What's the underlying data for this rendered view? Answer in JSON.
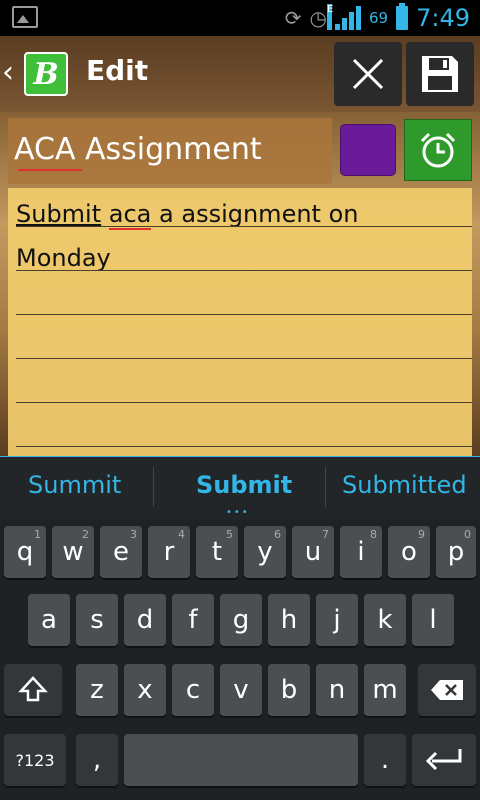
{
  "statusbar": {
    "battery": "69",
    "network": "E",
    "time": "7:49"
  },
  "actionbar": {
    "back": "‹",
    "logo": "B",
    "title": "Edit",
    "discard": "✕",
    "save": "save-icon"
  },
  "note": {
    "title": "ACA Assignment",
    "color": "#6a1b9a",
    "body_line1_word1": "Submit",
    "body_line1_word2": "aca",
    "body_line1_rest": " a assignment on",
    "body_line2": "Monday"
  },
  "suggestions": {
    "left": "Summit",
    "mid": "Submit",
    "right": "Submitted"
  },
  "keys": {
    "row1": [
      "q",
      "w",
      "e",
      "r",
      "t",
      "y",
      "u",
      "i",
      "o",
      "p"
    ],
    "row1_hints": [
      "1",
      "2",
      "3",
      "4",
      "5",
      "6",
      "7",
      "8",
      "9",
      "0"
    ],
    "row2": [
      "a",
      "s",
      "d",
      "f",
      "g",
      "h",
      "j",
      "k",
      "l"
    ],
    "row3": [
      "z",
      "x",
      "c",
      "v",
      "b",
      "n",
      "m"
    ],
    "symbols": "?123",
    "comma": ",",
    "period": "."
  },
  "colors": {
    "accent": "#33b5e5",
    "note": "#f2cd6e",
    "alarm": "#2e9a2c"
  }
}
